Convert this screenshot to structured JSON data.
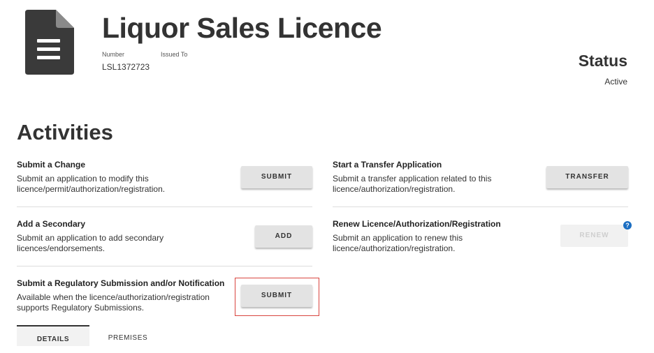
{
  "header": {
    "title": "Liquor Sales Licence",
    "number_label": "Number",
    "issued_to_label": "Issued To",
    "number_value": "LSL1372723"
  },
  "status": {
    "title": "Status",
    "value": "Active"
  },
  "activities": {
    "title": "Activities",
    "items": [
      {
        "title": "Submit a Change",
        "desc_line1": "Submit an application to modify this",
        "desc_line2": "licence/permit/authorization/registration.",
        "button": "SUBMIT"
      },
      {
        "title": "Start a Transfer Application",
        "desc_line1": "Submit a transfer application related to this",
        "desc_line2": "licence/authorization/registration.",
        "button": "TRANSFER"
      },
      {
        "title": "Add a Secondary",
        "desc_line1": "Submit an application to add secondary",
        "desc_line2": "licences/endorsements.",
        "button": "ADD"
      },
      {
        "title": "Renew Licence/Authorization/Registration",
        "desc_line1": "Submit an application to renew this",
        "desc_line2": "licence/authorization/registration.",
        "button": "RENEW",
        "button_disabled": true
      },
      {
        "title": "Submit a Regulatory Submission and/or Notification",
        "desc_line1": "Available when the licence/authorization/registration",
        "desc_line2": "supports Regulatory Submissions.",
        "button": "SUBMIT"
      }
    ]
  },
  "help_icon_glyph": "?",
  "tabs": [
    {
      "label": "DETAILS",
      "active": true
    },
    {
      "label": "PREMISES",
      "active": false
    }
  ],
  "colors": {
    "highlight_border": "#d9453f",
    "help_icon": "#1b6ec2",
    "button_bg": "#e3e3e3",
    "icon_dark": "#3a3a3a"
  }
}
